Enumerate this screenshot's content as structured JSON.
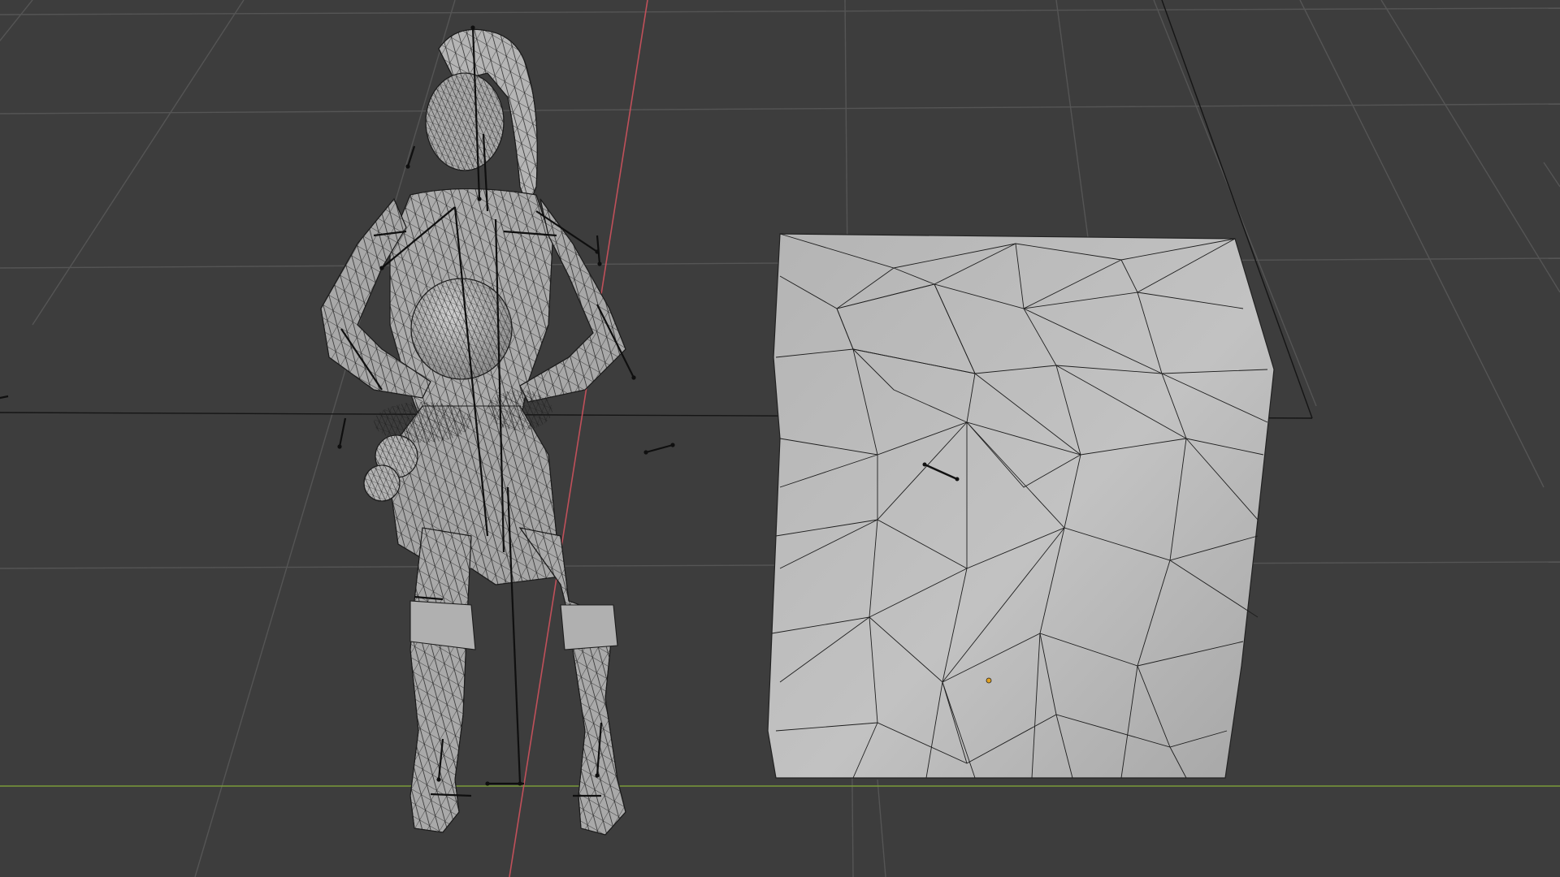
{
  "viewport": {
    "mode": "3d-viewport",
    "shading": "solid-wireframe-overlay",
    "background_color": "#3d3d3d",
    "grid_color": "#555555",
    "x_axis_color": "#c0505a",
    "y_axis_color": "#7a9a3a",
    "mesh_color": "#bdbdbd",
    "wire_color": "#1a1a1a",
    "bone_color": "#111111",
    "origin_color": "#e0a020"
  },
  "objects": [
    {
      "name": "character",
      "kind": "armature-mesh",
      "icon": "character-mesh-icon"
    },
    {
      "name": "cube",
      "kind": "mesh",
      "icon": "cube-mesh-icon"
    },
    {
      "name": "ground-plane",
      "kind": "mesh-outline",
      "icon": "plane-icon"
    }
  ]
}
